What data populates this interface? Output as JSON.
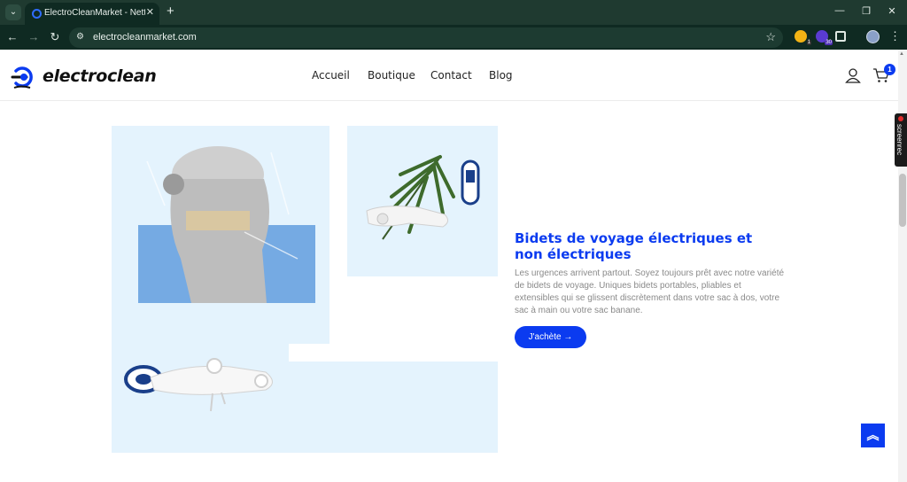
{
  "browser": {
    "tab_title": "ElectroCleanMarket - Nettoyag",
    "url": "electrocleanmarket.com",
    "extension_badges": [
      "1",
      "30"
    ]
  },
  "site": {
    "logo_text": "electroclean",
    "nav": [
      "Accueil",
      "Boutique",
      "Contact",
      "Blog"
    ],
    "cart_count": "1"
  },
  "screenrec_label": "screenrec",
  "hero": {
    "title": "Bidets de voyage électriques et non électriques",
    "description": "Les urgences arrivent partout. Soyez toujours prêt avec notre variété de bidets de voyage. Uniques bidets portables, pliables et extensibles qui se glissent discrètement dans votre sac à dos, votre sac à main ou votre sac banane.",
    "cta_label": "J'achète →"
  },
  "colors": {
    "brand": "#0b3bf0",
    "tile": "#e4f3fd",
    "chrome": "#0f2a22"
  },
  "icons": [
    "user-icon",
    "cart-icon",
    "chevron-up-icon",
    "arrow-right-icon"
  ]
}
